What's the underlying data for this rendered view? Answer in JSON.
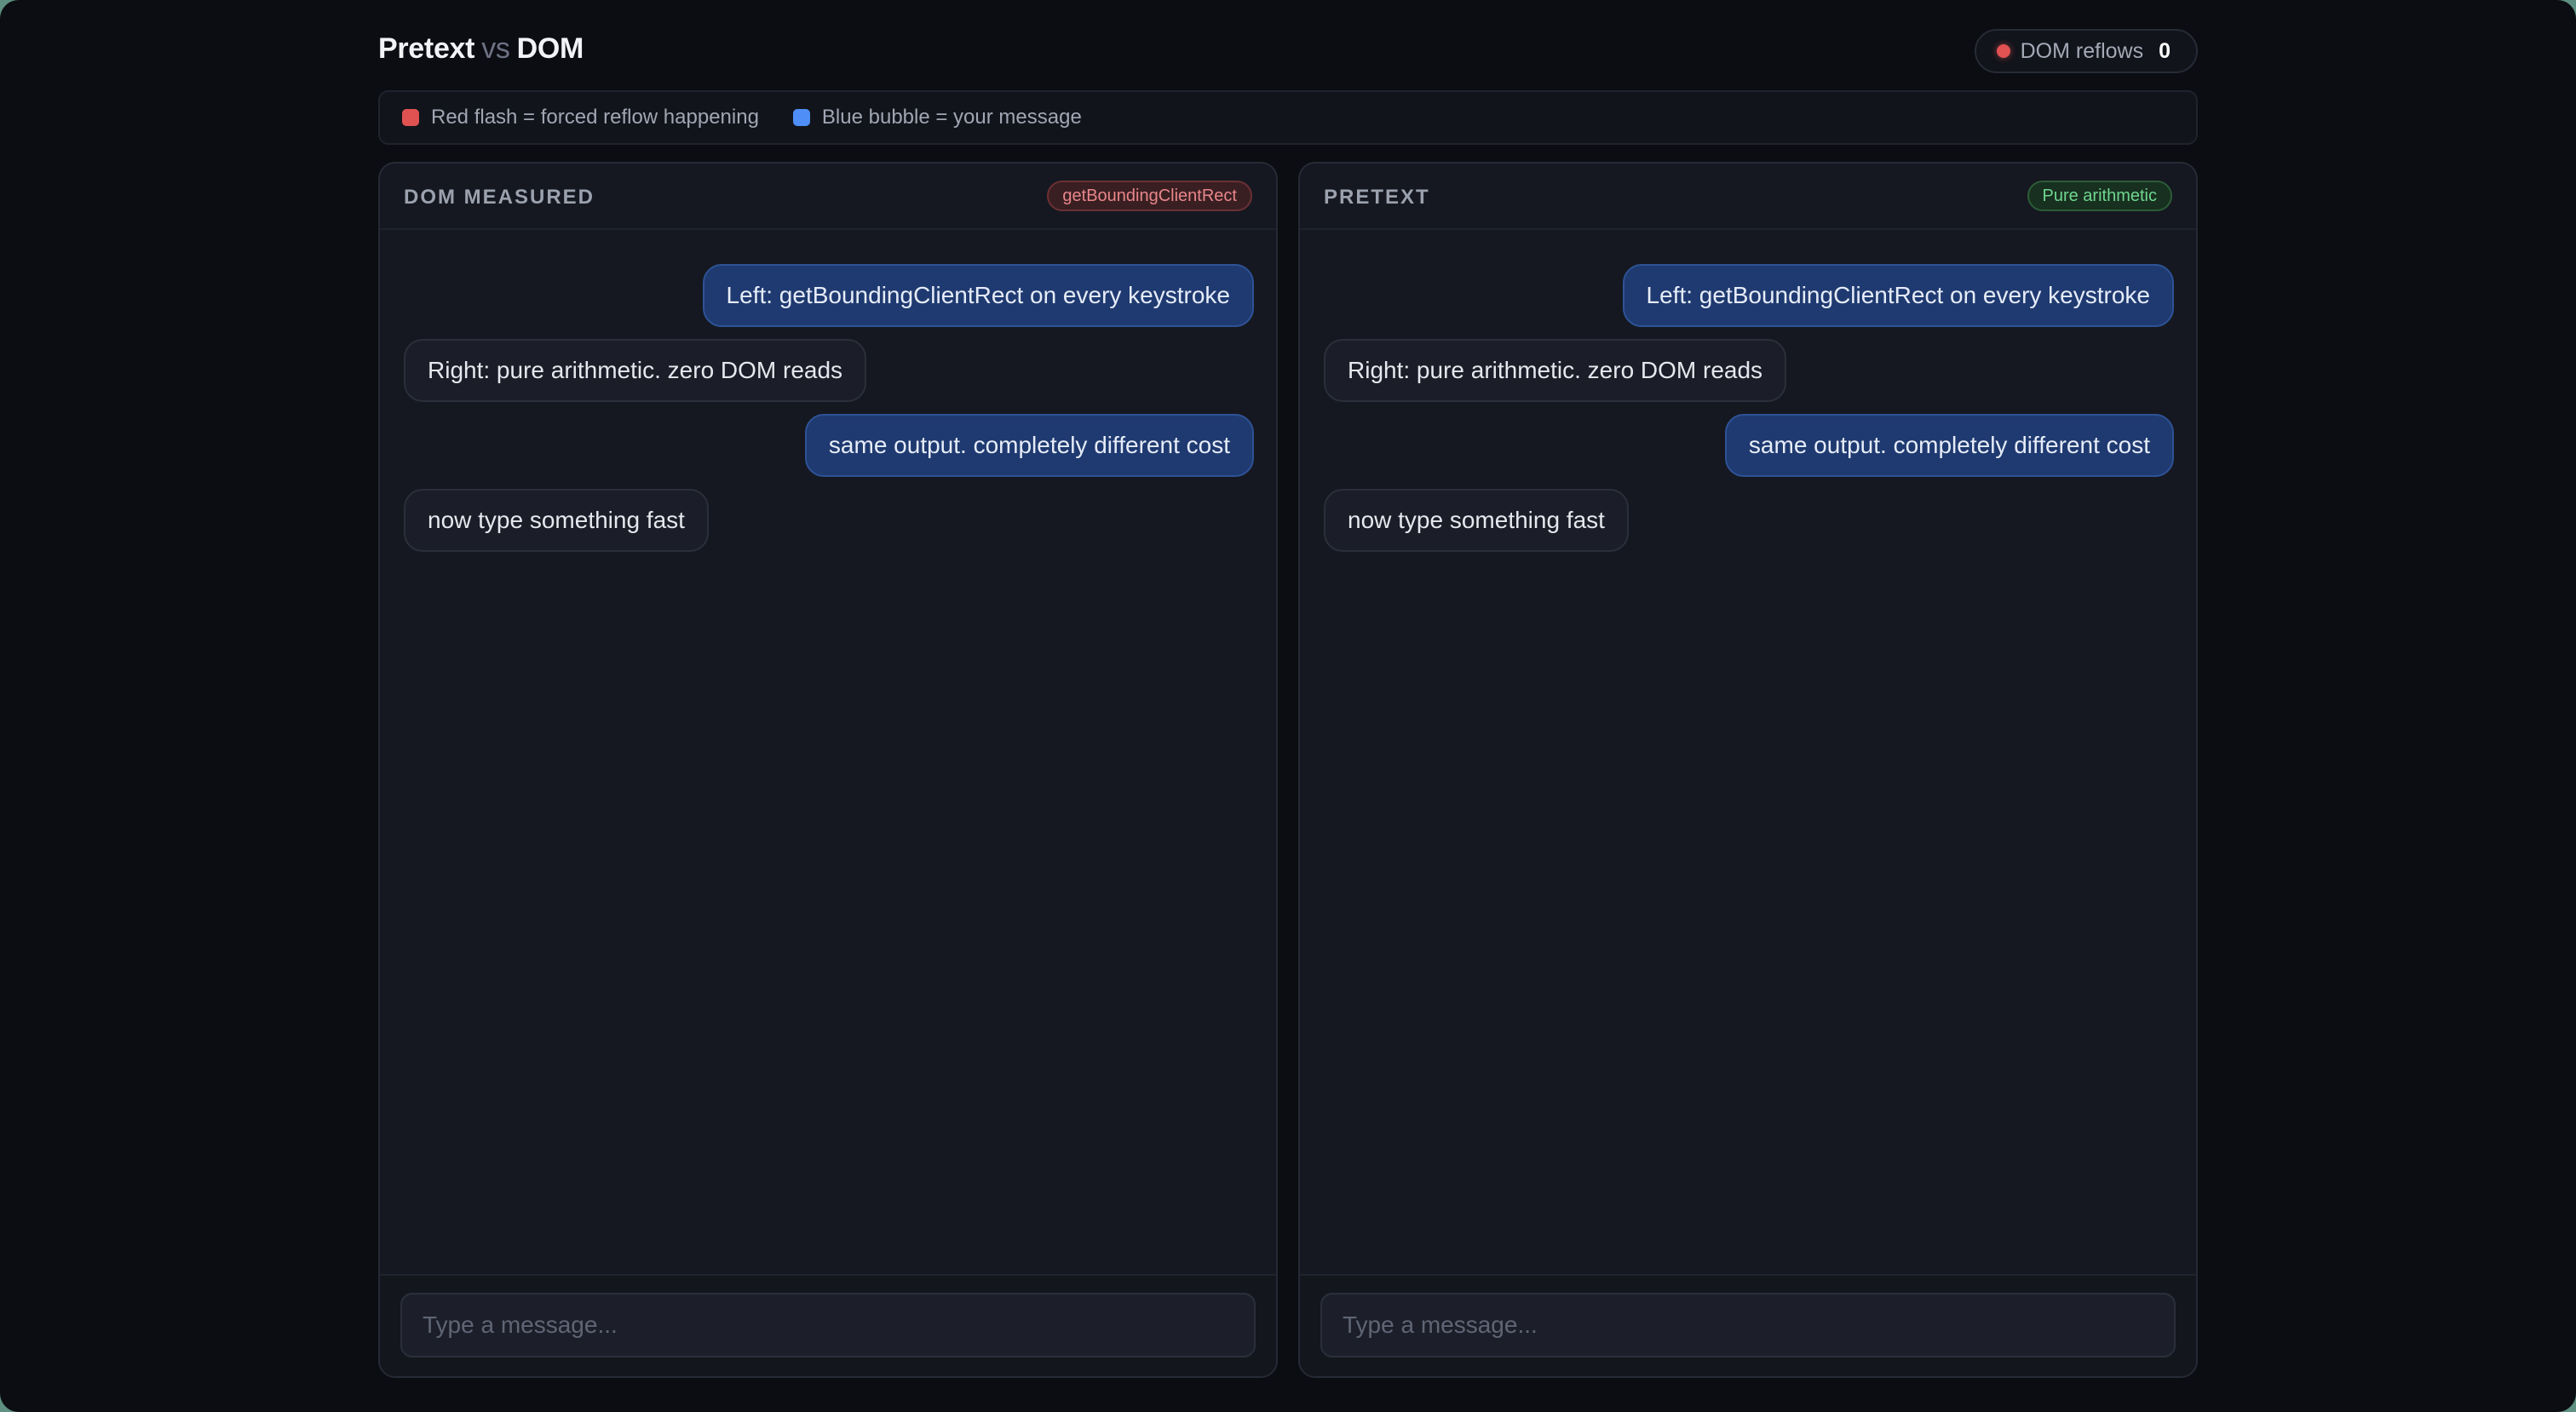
{
  "header": {
    "title_a": "Pretext",
    "title_vs": "vs",
    "title_b": "DOM",
    "reflow_label": "DOM reflows",
    "reflow_count": "0"
  },
  "legend": [
    {
      "text": "Red flash = forced reflow happening",
      "color": "#e05252"
    },
    {
      "text": "Blue bubble = your message",
      "color": "#4f8ef7"
    }
  ],
  "panels": {
    "left": {
      "title": "DOM MEASURED",
      "badge": "getBoundingClientRect",
      "badge_color": "red",
      "messages": [
        {
          "from": "out",
          "text": "Left: getBoundingClientRect on every keystroke"
        },
        {
          "from": "in",
          "text": "Right: pure arithmetic. zero DOM reads"
        },
        {
          "from": "out",
          "text": "same output. completely different cost"
        },
        {
          "from": "in",
          "text": "now type something fast"
        }
      ],
      "input_placeholder": "Type a message..."
    },
    "right": {
      "title": "PRETEXT",
      "badge": "Pure arithmetic",
      "badge_color": "green",
      "messages": [
        {
          "from": "out",
          "text": "Left: getBoundingClientRect on every keystroke"
        },
        {
          "from": "in",
          "text": "Right: pure arithmetic. zero DOM reads"
        },
        {
          "from": "out",
          "text": "same output. completely different cost"
        },
        {
          "from": "in",
          "text": "now type something fast"
        }
      ],
      "input_placeholder": "Type a message..."
    }
  }
}
